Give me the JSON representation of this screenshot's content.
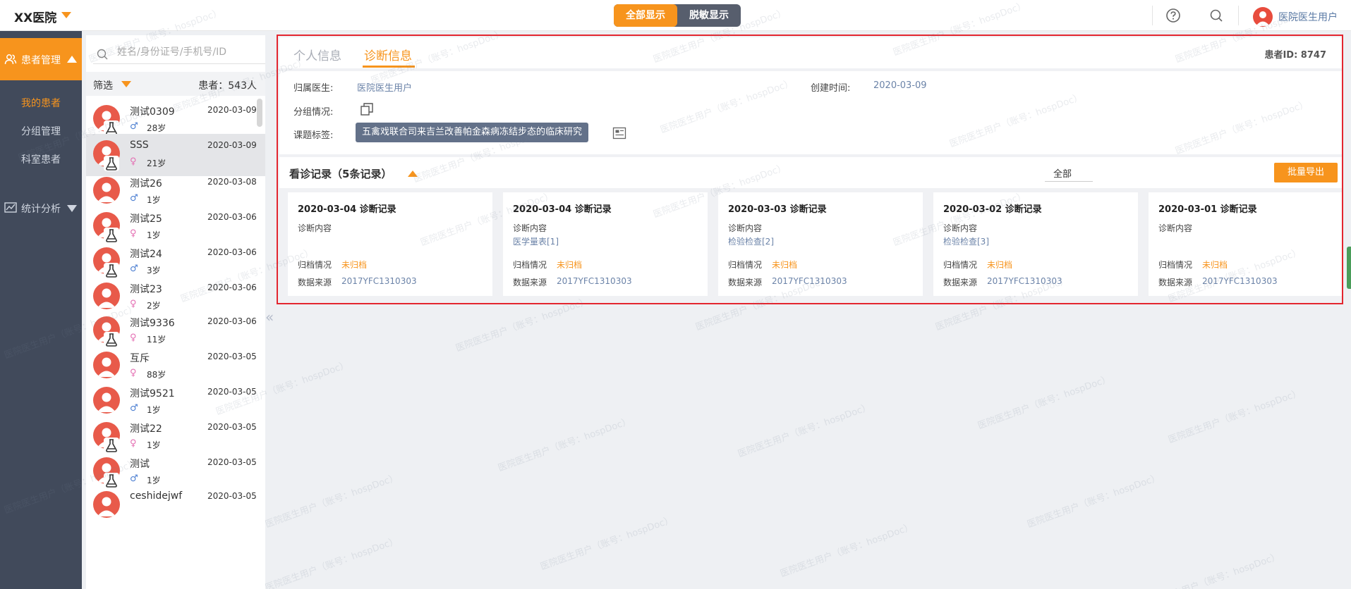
{
  "header": {
    "hospital": "XX医院",
    "toggle": {
      "full": "全部显示",
      "masked": "脱敏显示"
    },
    "user_name": "医院医生用户"
  },
  "nav": {
    "patients": "患者管理",
    "my_patients": "我的患者",
    "group_manage": "分组管理",
    "dept_patients": "科室患者",
    "stats": "统计分析"
  },
  "patient_list": {
    "search_placeholder": "姓名/身份证号/手机号/ID",
    "filter_label": "筛选",
    "count": "患者：543人",
    "rows": [
      {
        "name": "测试0309",
        "date": "2020-03-09",
        "sex": "♂",
        "age": "28岁",
        "sex_type": "male",
        "flask": true
      },
      {
        "name": "SSS",
        "date": "2020-03-09",
        "sex": "♀",
        "age": "21岁",
        "sex_type": "female",
        "flask": true
      },
      {
        "name": "测试26",
        "date": "2020-03-08",
        "sex": "♂",
        "age": "1岁",
        "sex_type": "male",
        "flask": false
      },
      {
        "name": "测试25",
        "date": "2020-03-06",
        "sex": "♀",
        "age": "1岁",
        "sex_type": "female",
        "flask": true
      },
      {
        "name": "测试24",
        "date": "2020-03-06",
        "sex": "♂",
        "age": "3岁",
        "sex_type": "male",
        "flask": true
      },
      {
        "name": "测试23",
        "date": "2020-03-06",
        "sex": "♀",
        "age": "2岁",
        "sex_type": "female",
        "flask": false
      },
      {
        "name": "测试9336",
        "date": "2020-03-06",
        "sex": "♀",
        "age": "11岁",
        "sex_type": "female",
        "flask": true
      },
      {
        "name": "互斥",
        "date": "2020-03-05",
        "sex": "♀",
        "age": "88岁",
        "sex_type": "female",
        "flask": false
      },
      {
        "name": "测试9521",
        "date": "2020-03-05",
        "sex": "♂",
        "age": "1岁",
        "sex_type": "male",
        "flask": false
      },
      {
        "name": "测试22",
        "date": "2020-03-05",
        "sex": "♀",
        "age": "1岁",
        "sex_type": "female",
        "flask": true
      },
      {
        "name": "测试",
        "date": "2020-03-05",
        "sex": "♂",
        "age": "1岁",
        "sex_type": "male",
        "flask": true
      },
      {
        "name": "ceshidejwf",
        "date": "2020-03-05",
        "sex": "",
        "age": "",
        "sex_type": "male",
        "flask": false
      }
    ]
  },
  "main": {
    "tabs": {
      "personal": "个人信息",
      "diagnosis": "诊断信息"
    },
    "patient_id": "患者ID: 8747",
    "info": {
      "doctor_label": "归属医生:",
      "doctor_value": "医院医生用户",
      "created_label": "创建时间:",
      "created_value": "2020-03-09",
      "group_label": "分组情况:",
      "topic_label": "课题标签:",
      "topic_value": "五禽戏联合司来吉兰改善帕金森病冻结步态的临床研究"
    },
    "visits": {
      "title": "看诊记录（5条记录）",
      "filter": "全部",
      "export": "批量导出",
      "cards": [
        {
          "title": "2020-03-04 诊断记录",
          "content_label": "诊断内容",
          "detail": "",
          "archive_label": "归档情况",
          "archive_value": "未归档",
          "source_label": "数据来源",
          "source_value": "2017YFC1310303"
        },
        {
          "title": "2020-03-04 诊断记录",
          "content_label": "诊断内容",
          "detail": "医学量表[1]",
          "archive_label": "归档情况",
          "archive_value": "未归档",
          "source_label": "数据来源",
          "source_value": "2017YFC1310303"
        },
        {
          "title": "2020-03-03 诊断记录",
          "content_label": "诊断内容",
          "detail": "检验检查[2]",
          "archive_label": "归档情况",
          "archive_value": "未归档",
          "source_label": "数据来源",
          "source_value": "2017YFC1310303"
        },
        {
          "title": "2020-03-02 诊断记录",
          "content_label": "诊断内容",
          "detail": "检验检查[3]",
          "archive_label": "归档情况",
          "archive_value": "未归档",
          "source_label": "数据来源",
          "source_value": "2017YFC1310303"
        },
        {
          "title": "2020-03-01 诊断记录",
          "content_label": "诊断内容",
          "detail": "",
          "archive_label": "归档情况",
          "archive_value": "未归档",
          "source_label": "数据来源",
          "source_value": "2017YFC1310303"
        }
      ]
    }
  },
  "watermark": "医院医生用户（账号：hospDoc）",
  "colors": {
    "accent": "#f7941d",
    "nav_bg": "#414a5b",
    "highlight_border": "#e3262f"
  }
}
